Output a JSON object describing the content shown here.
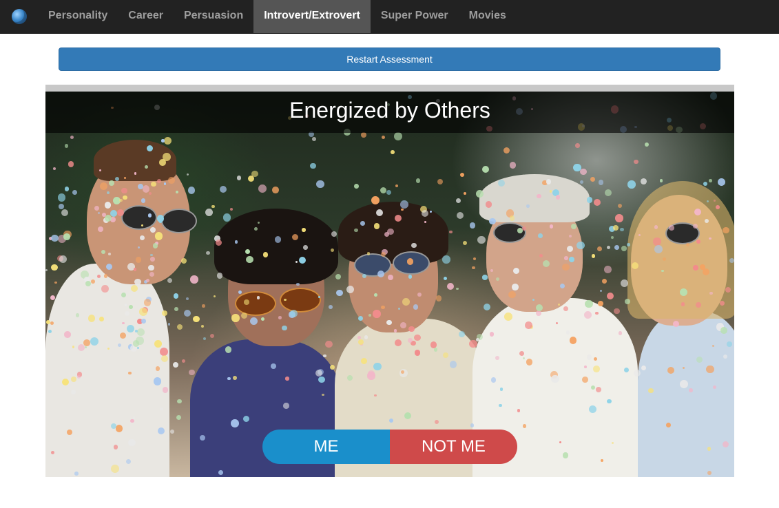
{
  "nav": {
    "brand_icon": "globe-logo-icon",
    "items": [
      {
        "label": "Personality",
        "active": false
      },
      {
        "label": "Career",
        "active": false
      },
      {
        "label": "Persuasion",
        "active": false
      },
      {
        "label": "Introvert/Extrovert",
        "active": true
      },
      {
        "label": "Super Power",
        "active": false
      },
      {
        "label": "Movies",
        "active": false
      }
    ]
  },
  "restart": {
    "label": "Restart Assessment"
  },
  "question": {
    "title": "Energized by Others",
    "image": "friends-blowing-confetti-photo"
  },
  "answers": {
    "me_label": "ME",
    "not_me_label": "NOT ME"
  },
  "colors": {
    "navbar": "#222222",
    "nav_active": "#555555",
    "primary_button": "#337ab7",
    "me_button": "#1a8fcb",
    "not_me_button": "#cf4a4a"
  }
}
